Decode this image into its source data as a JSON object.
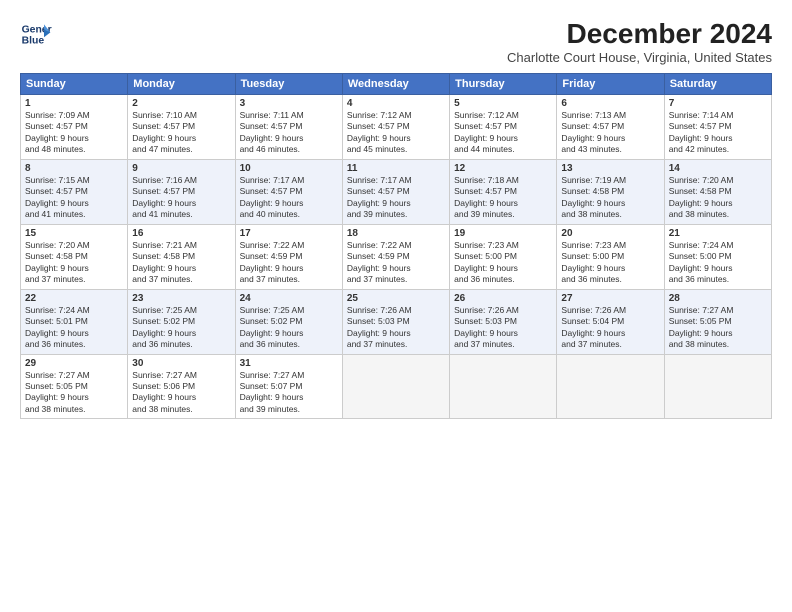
{
  "header": {
    "logo_line1": "General",
    "logo_line2": "Blue",
    "title": "December 2024",
    "subtitle": "Charlotte Court House, Virginia, United States"
  },
  "columns": [
    "Sunday",
    "Monday",
    "Tuesday",
    "Wednesday",
    "Thursday",
    "Friday",
    "Saturday"
  ],
  "weeks": [
    [
      {
        "day": "1",
        "info": "Sunrise: 7:09 AM\nSunset: 4:57 PM\nDaylight: 9 hours\nand 48 minutes."
      },
      {
        "day": "2",
        "info": "Sunrise: 7:10 AM\nSunset: 4:57 PM\nDaylight: 9 hours\nand 47 minutes."
      },
      {
        "day": "3",
        "info": "Sunrise: 7:11 AM\nSunset: 4:57 PM\nDaylight: 9 hours\nand 46 minutes."
      },
      {
        "day": "4",
        "info": "Sunrise: 7:12 AM\nSunset: 4:57 PM\nDaylight: 9 hours\nand 45 minutes."
      },
      {
        "day": "5",
        "info": "Sunrise: 7:12 AM\nSunset: 4:57 PM\nDaylight: 9 hours\nand 44 minutes."
      },
      {
        "day": "6",
        "info": "Sunrise: 7:13 AM\nSunset: 4:57 PM\nDaylight: 9 hours\nand 43 minutes."
      },
      {
        "day": "7",
        "info": "Sunrise: 7:14 AM\nSunset: 4:57 PM\nDaylight: 9 hours\nand 42 minutes."
      }
    ],
    [
      {
        "day": "8",
        "info": "Sunrise: 7:15 AM\nSunset: 4:57 PM\nDaylight: 9 hours\nand 41 minutes."
      },
      {
        "day": "9",
        "info": "Sunrise: 7:16 AM\nSunset: 4:57 PM\nDaylight: 9 hours\nand 41 minutes."
      },
      {
        "day": "10",
        "info": "Sunrise: 7:17 AM\nSunset: 4:57 PM\nDaylight: 9 hours\nand 40 minutes."
      },
      {
        "day": "11",
        "info": "Sunrise: 7:17 AM\nSunset: 4:57 PM\nDaylight: 9 hours\nand 39 minutes."
      },
      {
        "day": "12",
        "info": "Sunrise: 7:18 AM\nSunset: 4:57 PM\nDaylight: 9 hours\nand 39 minutes."
      },
      {
        "day": "13",
        "info": "Sunrise: 7:19 AM\nSunset: 4:58 PM\nDaylight: 9 hours\nand 38 minutes."
      },
      {
        "day": "14",
        "info": "Sunrise: 7:20 AM\nSunset: 4:58 PM\nDaylight: 9 hours\nand 38 minutes."
      }
    ],
    [
      {
        "day": "15",
        "info": "Sunrise: 7:20 AM\nSunset: 4:58 PM\nDaylight: 9 hours\nand 37 minutes."
      },
      {
        "day": "16",
        "info": "Sunrise: 7:21 AM\nSunset: 4:58 PM\nDaylight: 9 hours\nand 37 minutes."
      },
      {
        "day": "17",
        "info": "Sunrise: 7:22 AM\nSunset: 4:59 PM\nDaylight: 9 hours\nand 37 minutes."
      },
      {
        "day": "18",
        "info": "Sunrise: 7:22 AM\nSunset: 4:59 PM\nDaylight: 9 hours\nand 37 minutes."
      },
      {
        "day": "19",
        "info": "Sunrise: 7:23 AM\nSunset: 5:00 PM\nDaylight: 9 hours\nand 36 minutes."
      },
      {
        "day": "20",
        "info": "Sunrise: 7:23 AM\nSunset: 5:00 PM\nDaylight: 9 hours\nand 36 minutes."
      },
      {
        "day": "21",
        "info": "Sunrise: 7:24 AM\nSunset: 5:00 PM\nDaylight: 9 hours\nand 36 minutes."
      }
    ],
    [
      {
        "day": "22",
        "info": "Sunrise: 7:24 AM\nSunset: 5:01 PM\nDaylight: 9 hours\nand 36 minutes."
      },
      {
        "day": "23",
        "info": "Sunrise: 7:25 AM\nSunset: 5:02 PM\nDaylight: 9 hours\nand 36 minutes."
      },
      {
        "day": "24",
        "info": "Sunrise: 7:25 AM\nSunset: 5:02 PM\nDaylight: 9 hours\nand 36 minutes."
      },
      {
        "day": "25",
        "info": "Sunrise: 7:26 AM\nSunset: 5:03 PM\nDaylight: 9 hours\nand 37 minutes."
      },
      {
        "day": "26",
        "info": "Sunrise: 7:26 AM\nSunset: 5:03 PM\nDaylight: 9 hours\nand 37 minutes."
      },
      {
        "day": "27",
        "info": "Sunrise: 7:26 AM\nSunset: 5:04 PM\nDaylight: 9 hours\nand 37 minutes."
      },
      {
        "day": "28",
        "info": "Sunrise: 7:27 AM\nSunset: 5:05 PM\nDaylight: 9 hours\nand 38 minutes."
      }
    ],
    [
      {
        "day": "29",
        "info": "Sunrise: 7:27 AM\nSunset: 5:05 PM\nDaylight: 9 hours\nand 38 minutes."
      },
      {
        "day": "30",
        "info": "Sunrise: 7:27 AM\nSunset: 5:06 PM\nDaylight: 9 hours\nand 38 minutes."
      },
      {
        "day": "31",
        "info": "Sunrise: 7:27 AM\nSunset: 5:07 PM\nDaylight: 9 hours\nand 39 minutes."
      },
      null,
      null,
      null,
      null
    ]
  ]
}
